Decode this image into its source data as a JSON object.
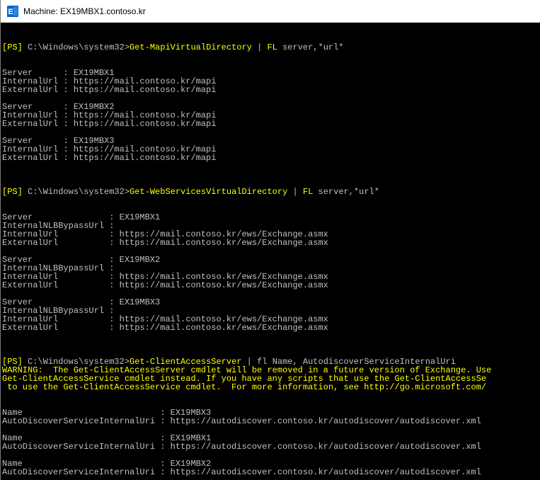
{
  "window": {
    "title": "Machine: EX19MBX1.contoso.kr",
    "icon": "exchange-management-shell-icon"
  },
  "colors": {
    "console_bg": "#000000",
    "console_text": "#c0c0c0",
    "highlight_yellow": "#ffff00",
    "icon_blue": "#0a64c8"
  },
  "console": {
    "cmd1": {
      "prompt": "[PS]",
      "path": " C:\\Windows\\system32>",
      "cmdlet": "Get-MapiVirtualDirectory",
      "pipe": " | ",
      "fl": "FL",
      "args": " server,*url*"
    },
    "mapi": [
      {
        "server": "Server      : EX19MBX1",
        "internal": "InternalUrl : https://mail.contoso.kr/mapi",
        "external": "ExternalUrl : https://mail.contoso.kr/mapi"
      },
      {
        "server": "Server      : EX19MBX2",
        "internal": "InternalUrl : https://mail.contoso.kr/mapi",
        "external": "ExternalUrl : https://mail.contoso.kr/mapi"
      },
      {
        "server": "Server      : EX19MBX3",
        "internal": "InternalUrl : https://mail.contoso.kr/mapi",
        "external": "ExternalUrl : https://mail.contoso.kr/mapi"
      }
    ],
    "cmd2": {
      "prompt": "[PS]",
      "path": " C:\\Windows\\system32>",
      "cmdlet": "Get-WebServicesVirtualDirectory",
      "pipe": " | ",
      "fl": "FL",
      "args": " server,*url*"
    },
    "ews": [
      {
        "server": "Server               : EX19MBX1",
        "nlb": "InternalNLBBypassUrl :",
        "internal": "InternalUrl          : https://mail.contoso.kr/ews/Exchange.asmx",
        "external": "ExternalUrl          : https://mail.contoso.kr/ews/Exchange.asmx"
      },
      {
        "server": "Server               : EX19MBX2",
        "nlb": "InternalNLBBypassUrl :",
        "internal": "InternalUrl          : https://mail.contoso.kr/ews/Exchange.asmx",
        "external": "ExternalUrl          : https://mail.contoso.kr/ews/Exchange.asmx"
      },
      {
        "server": "Server               : EX19MBX3",
        "nlb": "InternalNLBBypassUrl :",
        "internal": "InternalUrl          : https://mail.contoso.kr/ews/Exchange.asmx",
        "external": "ExternalUrl          : https://mail.contoso.kr/ews/Exchange.asmx"
      }
    ],
    "cmd3": {
      "prompt": "[PS]",
      "path": " C:\\Windows\\system32>",
      "cmdlet": "Get-ClientAccessServer",
      "pipe": " | ",
      "fl": "fl",
      "args": " Name, AutodiscoverServiceInternalUri"
    },
    "warning": [
      "WARNING:  The Get-ClientAccessServer cmdlet will be removed in a future version of Exchange. Use",
      "Get-ClientAccessService cmdlet instead. If you have any scripts that use the Get-ClientAccessSe",
      " to use the Get-ClientAccessService cmdlet.  For more information, see http://go.microsoft.com/"
    ],
    "cas": [
      {
        "name": "Name                           : EX19MBX3",
        "uri": "AutoDiscoverServiceInternalUri : https://autodiscover.contoso.kr/autodiscover/autodiscover.xml"
      },
      {
        "name": "Name                           : EX19MBX1",
        "uri": "AutoDiscoverServiceInternalUri : https://autodiscover.contoso.kr/autodiscover/autodiscover.xml"
      },
      {
        "name": "Name                           : EX19MBX2",
        "uri": "AutoDiscoverServiceInternalUri : https://autodiscover.contoso.kr/autodiscover/autodiscover.xml"
      }
    ]
  }
}
